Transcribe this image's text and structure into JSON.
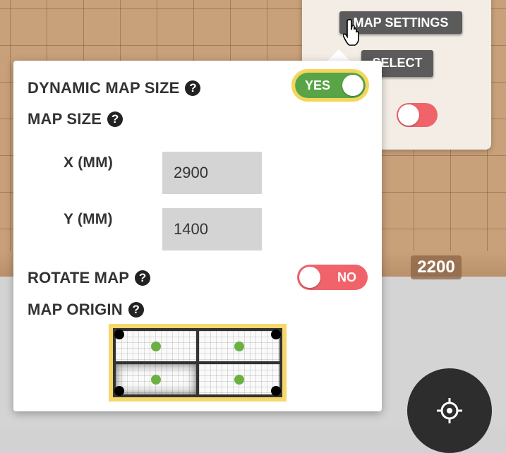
{
  "background": {
    "coordinate_badge": "2200"
  },
  "settings_menu": {
    "map_settings_label": "MAP SETTINGS",
    "select_label": "SELECT",
    "toggle_state": "off"
  },
  "popup": {
    "dynamic_map_size": {
      "label": "DYNAMIC MAP SIZE",
      "toggle_text": "YES",
      "enabled": true
    },
    "map_size": {
      "label": "MAP SIZE",
      "x_label": "X (MM)",
      "x_value": "2900",
      "y_label": "Y (MM)",
      "y_value": "1400"
    },
    "rotate_map": {
      "label": "ROTATE MAP",
      "toggle_text": "NO",
      "enabled": false
    },
    "map_origin": {
      "label": "MAP ORIGIN",
      "quadrants": [
        "top-left",
        "top-right",
        "bottom-left",
        "bottom-right"
      ],
      "selected": "bottom-left"
    }
  },
  "icons": {
    "help": "question-circle-icon",
    "locate": "crosshair-icon",
    "cursor": "hand-pointer-icon"
  },
  "colors": {
    "toggle_on": "#58a446",
    "toggle_off": "#f0636a",
    "highlight": "#f5d65a",
    "dot": "#6bb043"
  }
}
